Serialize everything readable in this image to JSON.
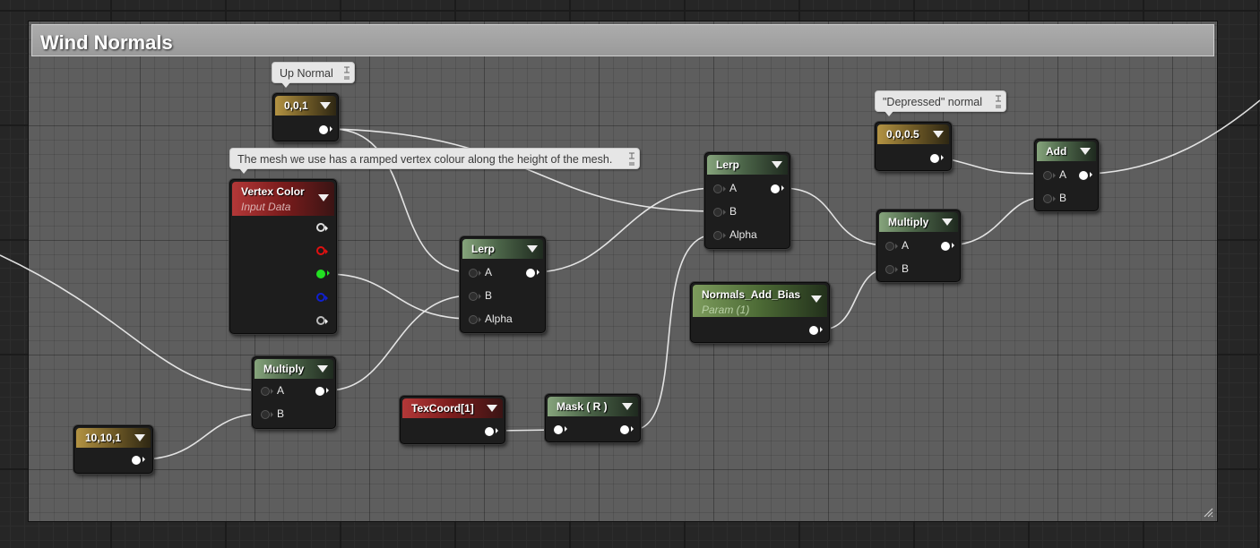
{
  "comment": {
    "title": "Wind Normals"
  },
  "bubbles": {
    "up_normal": "Up Normal",
    "mesh_note": "The mesh we use has a ramped vertex colour along the height of the mesh.",
    "depressed": "\"Depressed\" normal"
  },
  "nodes": {
    "const_up": {
      "title": "0,0,1"
    },
    "vertex_color": {
      "title": "Vertex Color",
      "subtitle": "Input Data"
    },
    "lerp_1": {
      "title": "Lerp",
      "pins": [
        "A",
        "B",
        "Alpha"
      ]
    },
    "lerp_2": {
      "title": "Lerp",
      "pins": [
        "A",
        "B",
        "Alpha"
      ]
    },
    "const_depressed": {
      "title": "0,0,0.5"
    },
    "multiply_1": {
      "title": "Multiply",
      "pins": [
        "A",
        "B"
      ]
    },
    "multiply_2": {
      "title": "Multiply",
      "pins": [
        "A",
        "B"
      ]
    },
    "add": {
      "title": "Add",
      "pins": [
        "A",
        "B"
      ]
    },
    "normals_param": {
      "title": "Normals_Add_Bias",
      "subtitle": "Param (1)"
    },
    "const_scale": {
      "title": "10,10,1"
    },
    "texcoord": {
      "title": "TexCoord[1]"
    },
    "mask": {
      "title": "Mask ( R )"
    }
  },
  "colors": {
    "wire": "#f2f2f2",
    "vertex_output_white": "#dddddd",
    "vertex_output_red": "#e01010",
    "vertex_output_green": "#22e022",
    "vertex_output_blue": "#1020d0",
    "vertex_output_alpha": "#bbbbbb"
  }
}
